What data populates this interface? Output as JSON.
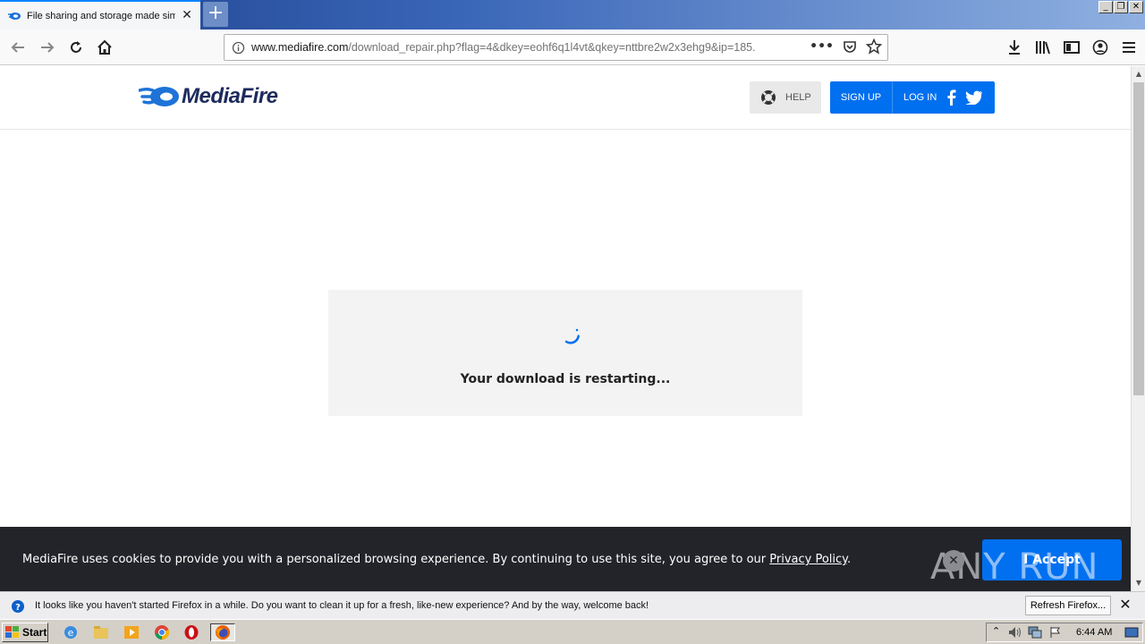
{
  "browser": {
    "tab_title": "File sharing and storage made simple",
    "new_tab_label": "+",
    "window_controls": [
      "_",
      "❐",
      "✕"
    ],
    "url_domain": "www.mediafire.com",
    "url_path": "/download_repair.php?flag=4&dkey=eohf6q1l4vt&qkey=nttbre2w2x3ehg9&ip=185.",
    "url_menu": "•••"
  },
  "site": {
    "logo_text": "MediaFire",
    "help_label": "HELP",
    "signup_label": "SIGN UP",
    "login_label": "LOG IN"
  },
  "main": {
    "restart_message": "Your download is restarting..."
  },
  "cookie_banner": {
    "message": "MediaFire uses cookies to provide you with a personalized browsing experience. By continuing to use this site, you agree to our ",
    "policy_link": "Privacy Policy",
    "period": ".",
    "accept_label": "I Accept",
    "close_symbol": "✕",
    "watermark": "ANY RUN"
  },
  "notification": {
    "text": "It looks like you haven't started Firefox in a while. Do you want to clean it up for a fresh, like-new experience? And by the way, welcome back!",
    "refresh_label": "Refresh Firefox...",
    "close_symbol": "✕"
  },
  "taskbar": {
    "start_label": "Start",
    "clock": "6:44 AM"
  },
  "colors": {
    "brand_blue": "#0070f0",
    "logo_navy": "#1d2a5c",
    "banner_bg": "#22242a"
  }
}
